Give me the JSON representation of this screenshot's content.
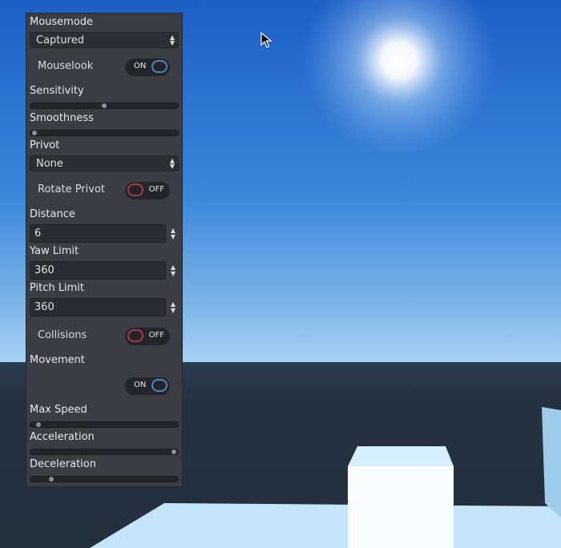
{
  "colors": {
    "panel_bg": "#3a3d44",
    "sky_top": "#1f63c8",
    "horizon": "#8ec0ea",
    "ground": "#263343",
    "floor": "#bfe2f8",
    "toggle_on": "#4a86c8",
    "toggle_off": "#a83a44"
  },
  "icons": {
    "cursor": "mouse-pointer-icon",
    "dropdown": "up-down-arrows-icon",
    "spinner": "up-down-arrows-icon"
  },
  "panel": {
    "mousemode": {
      "label": "Mousemode",
      "value": "Captured"
    },
    "mouselook": {
      "label": "Mouselook",
      "state": "ON"
    },
    "sensitivity": {
      "label": "Sensitivity",
      "value": 0.5
    },
    "smoothness": {
      "label": "Smoothness",
      "value": 0.0
    },
    "privot": {
      "label": "Privot",
      "value": "None"
    },
    "rotate_privot": {
      "label": "Rotate Privot",
      "state": "OFF"
    },
    "distance": {
      "label": "Distance",
      "value": "6"
    },
    "yaw_limit": {
      "label": "Yaw Limit",
      "value": "360"
    },
    "pitch_limit": {
      "label": "Pitch Limit",
      "value": "360"
    },
    "collisions": {
      "label": "Collisions",
      "state": "OFF"
    },
    "movement": {
      "label": "Movement",
      "state": "ON"
    },
    "max_speed": {
      "label": "Max Speed",
      "value": 0.03
    },
    "acceleration": {
      "label": "Acceleration",
      "value": 1.0
    },
    "deceleration": {
      "label": "Deceleration",
      "value": 0.12
    }
  }
}
